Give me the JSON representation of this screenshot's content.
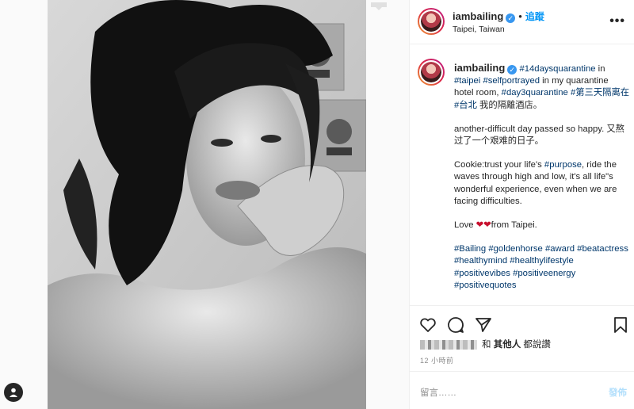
{
  "post": {
    "username": "iambailing",
    "follow_label": "追蹤",
    "location": "Taipei, Taiwan",
    "more_label": "•••"
  },
  "caption": {
    "username": "iambailing",
    "line1": [
      {
        "t": "#14daysquarantine",
        "tag": true
      },
      {
        "t": " in ",
        "tag": false
      },
      {
        "t": "#taipei",
        "tag": true
      },
      {
        "t": " ",
        "tag": false
      },
      {
        "t": "#selfportrayed",
        "tag": true
      },
      {
        "t": " in my quarantine hotel room, ",
        "tag": false
      },
      {
        "t": "#day3quarantine",
        "tag": true
      },
      {
        "t": " ",
        "tag": false
      },
      {
        "t": "#第三天隔离在",
        "tag": true
      },
      {
        "t": " ",
        "tag": false
      },
      {
        "t": "#台北",
        "tag": true
      },
      {
        "t": " 我的隔離酒店。",
        "tag": false
      }
    ],
    "para2": "another-difficult day passed so happy. 又熬过了一个艰难的日子。",
    "para3": [
      {
        "t": "Cookie:trust your life's ",
        "tag": false
      },
      {
        "t": "#purpose",
        "tag": true
      },
      {
        "t": ", ride the waves through high and low, it's all life\"s wonderful experience, even when we are facing difficulties.",
        "tag": false
      }
    ],
    "para4_prefix": "Love ",
    "para4_hearts": "❤❤",
    "para4_suffix": "from Taipei.",
    "hashtags": [
      "#Bailing",
      "#goldenhorse",
      "#award",
      "#beatactress",
      "#healthymind",
      "#healthylifestyle",
      "#positivevibes",
      "#positiveenergy",
      "#positivequotes"
    ]
  },
  "likes": {
    "and_label": "和",
    "others_label": "其他人",
    "suffix": "都說讚"
  },
  "timestamp": "12 小時前",
  "comment": {
    "placeholder": "留言……",
    "post_label": "發佈"
  }
}
